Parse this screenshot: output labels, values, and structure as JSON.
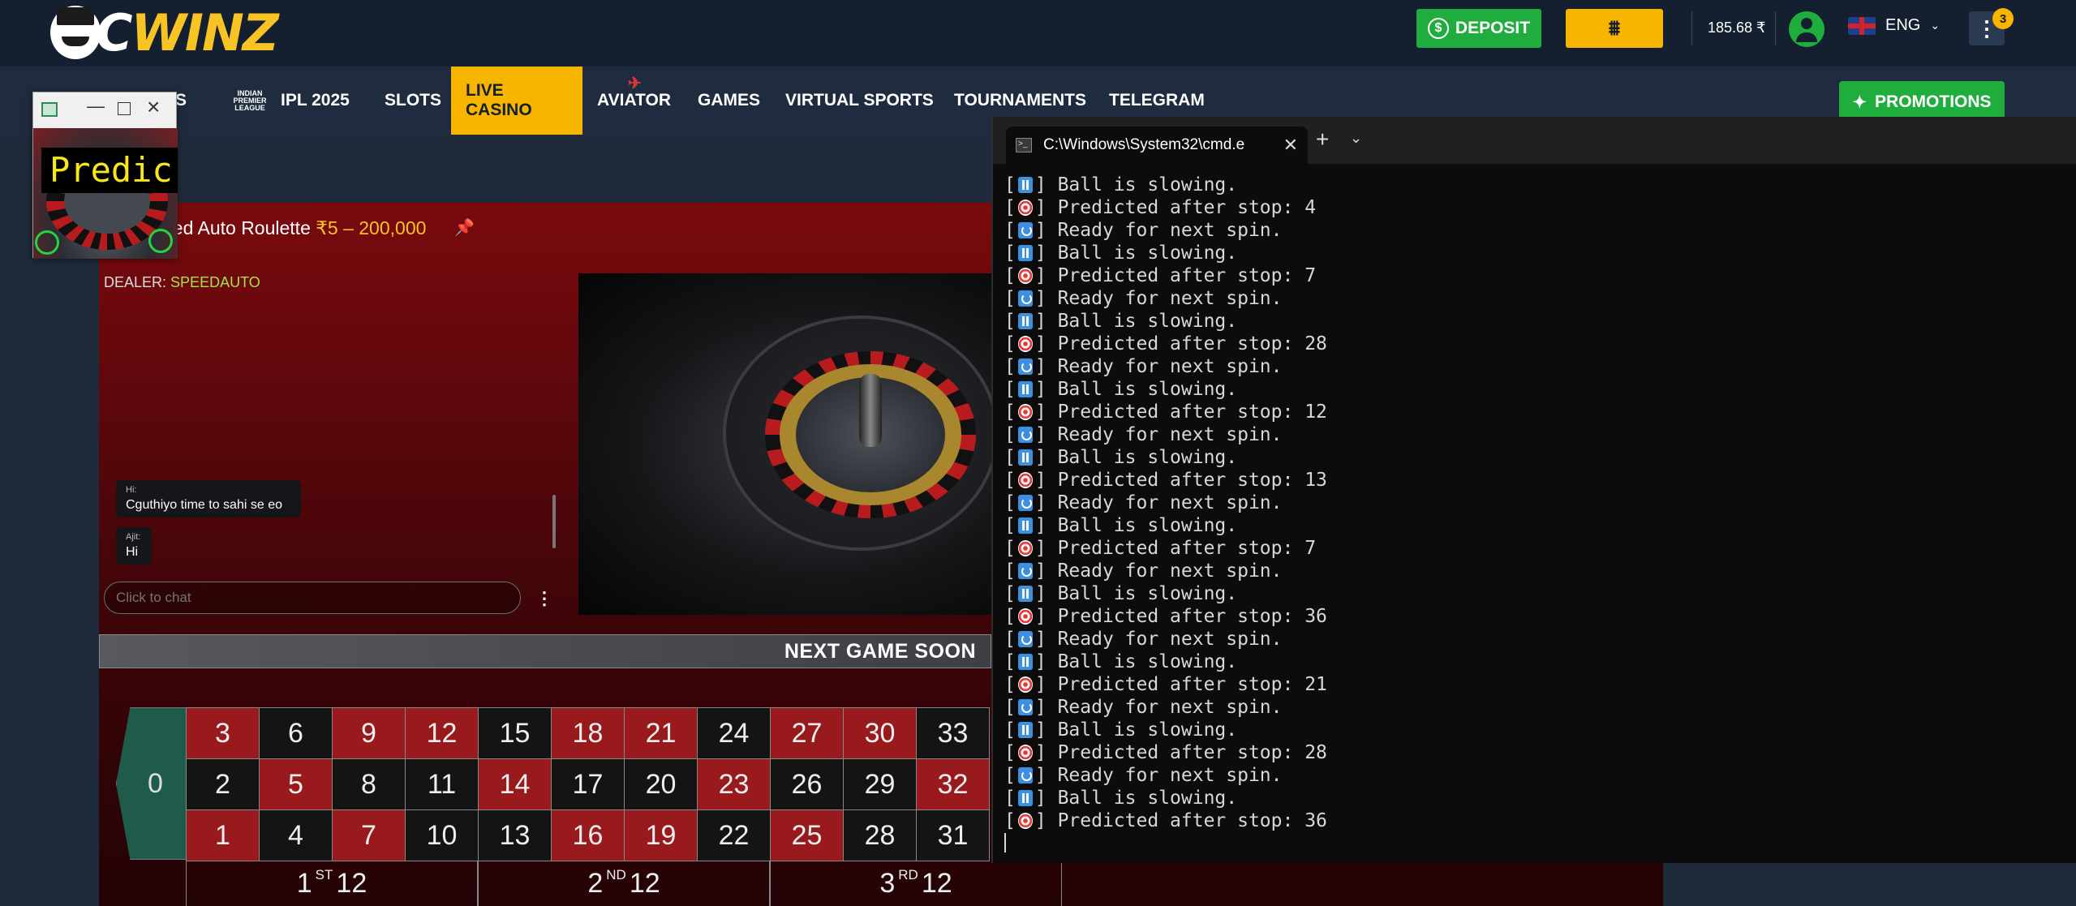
{
  "header": {
    "logo_text_first": "C",
    "logo_text_rest": "WINZ",
    "deposit_label": "DEPOSIT",
    "balance": "185.68 ₹",
    "language": "ENG",
    "notification_count": "3"
  },
  "nav": {
    "items": [
      {
        "label": "RTS"
      },
      {
        "label": "IPL 2025",
        "badge": "INDIAN PREMIER LEAGUE"
      },
      {
        "label": "SLOTS"
      },
      {
        "label": "LIVE CASINO"
      },
      {
        "label": "AVIATOR"
      },
      {
        "label": "GAMES"
      },
      {
        "label": "VIRTUAL SPORTS"
      },
      {
        "label": "TOURNAMENTS"
      },
      {
        "label": "TELEGRAM"
      }
    ],
    "active": "LIVE CASINO",
    "promotions_label": "PROMOTIONS"
  },
  "game": {
    "title": "eed Auto Roulette",
    "limits": "₹5 – 200,000",
    "dealer_label": "DEALER:",
    "dealer_name": "SPEEDAUTO",
    "status_banner": "NEXT GAME SOON",
    "zero": "0",
    "board_rows": [
      [
        {
          "n": "3",
          "c": "red"
        },
        {
          "n": "6",
          "c": "black"
        },
        {
          "n": "9",
          "c": "red"
        },
        {
          "n": "12",
          "c": "red"
        },
        {
          "n": "15",
          "c": "black"
        },
        {
          "n": "18",
          "c": "red"
        },
        {
          "n": "21",
          "c": "red"
        },
        {
          "n": "24",
          "c": "black"
        },
        {
          "n": "27",
          "c": "red"
        },
        {
          "n": "30",
          "c": "red"
        },
        {
          "n": "33",
          "c": "black"
        }
      ],
      [
        {
          "n": "2",
          "c": "black"
        },
        {
          "n": "5",
          "c": "red"
        },
        {
          "n": "8",
          "c": "black"
        },
        {
          "n": "11",
          "c": "black"
        },
        {
          "n": "14",
          "c": "red"
        },
        {
          "n": "17",
          "c": "black"
        },
        {
          "n": "20",
          "c": "black"
        },
        {
          "n": "23",
          "c": "red"
        },
        {
          "n": "26",
          "c": "black"
        },
        {
          "n": "29",
          "c": "black"
        },
        {
          "n": "32",
          "c": "red"
        }
      ],
      [
        {
          "n": "1",
          "c": "red"
        },
        {
          "n": "4",
          "c": "black"
        },
        {
          "n": "7",
          "c": "red"
        },
        {
          "n": "10",
          "c": "black"
        },
        {
          "n": "13",
          "c": "black"
        },
        {
          "n": "16",
          "c": "red"
        },
        {
          "n": "19",
          "c": "red"
        },
        {
          "n": "22",
          "c": "black"
        },
        {
          "n": "25",
          "c": "red"
        },
        {
          "n": "28",
          "c": "black"
        },
        {
          "n": "31",
          "c": "black"
        }
      ]
    ],
    "dozens": [
      {
        "prefix": "1",
        "sup": "ST",
        "suffix": "12"
      },
      {
        "prefix": "2",
        "sup": "ND",
        "suffix": "12"
      },
      {
        "prefix": "3",
        "sup": "RD",
        "suffix": "12"
      }
    ]
  },
  "chat": {
    "messages": [
      {
        "name": "Hi:",
        "text": "Cguthiyo time to sahi se eo"
      },
      {
        "name": "Ajit:",
        "text": "Hi"
      }
    ],
    "input_placeholder": "Click to chat"
  },
  "terminal": {
    "tab_title": "C:\\Windows\\System32\\cmd.e",
    "lines": [
      {
        "icon": "pause",
        "text": "Ball is slowing."
      },
      {
        "icon": "target",
        "text": "Predicted after stop: 4"
      },
      {
        "icon": "cycle",
        "text": "Ready for next spin."
      },
      {
        "icon": "pause",
        "text": "Ball is slowing."
      },
      {
        "icon": "target",
        "text": "Predicted after stop: 7"
      },
      {
        "icon": "cycle",
        "text": "Ready for next spin."
      },
      {
        "icon": "pause",
        "text": "Ball is slowing."
      },
      {
        "icon": "target",
        "text": "Predicted after stop: 28"
      },
      {
        "icon": "cycle",
        "text": "Ready for next spin."
      },
      {
        "icon": "pause",
        "text": "Ball is slowing."
      },
      {
        "icon": "target",
        "text": "Predicted after stop: 12"
      },
      {
        "icon": "cycle",
        "text": "Ready for next spin."
      },
      {
        "icon": "pause",
        "text": "Ball is slowing."
      },
      {
        "icon": "target",
        "text": "Predicted after stop: 13"
      },
      {
        "icon": "cycle",
        "text": "Ready for next spin."
      },
      {
        "icon": "pause",
        "text": "Ball is slowing."
      },
      {
        "icon": "target",
        "text": "Predicted after stop: 7"
      },
      {
        "icon": "cycle",
        "text": "Ready for next spin."
      },
      {
        "icon": "pause",
        "text": "Ball is slowing."
      },
      {
        "icon": "target",
        "text": "Predicted after stop: 36"
      },
      {
        "icon": "cycle",
        "text": "Ready for next spin."
      },
      {
        "icon": "pause",
        "text": "Ball is slowing."
      },
      {
        "icon": "target",
        "text": "Predicted after stop: 21"
      },
      {
        "icon": "cycle",
        "text": "Ready for next spin."
      },
      {
        "icon": "pause",
        "text": "Ball is slowing."
      },
      {
        "icon": "target",
        "text": "Predicted after stop: 28"
      },
      {
        "icon": "cycle",
        "text": "Ready for next spin."
      },
      {
        "icon": "pause",
        "text": "Ball is slowing."
      },
      {
        "icon": "target",
        "text": "Predicted after stop: 36"
      }
    ]
  },
  "mini_window": {
    "overlay_text": "Predic"
  },
  "colors": {
    "accent_yellow": "#f7b500",
    "accent_green": "#1fae3e",
    "header_bg": "#14202f",
    "table_red": "#981a1d",
    "zero_green": "#1f5b4b"
  }
}
